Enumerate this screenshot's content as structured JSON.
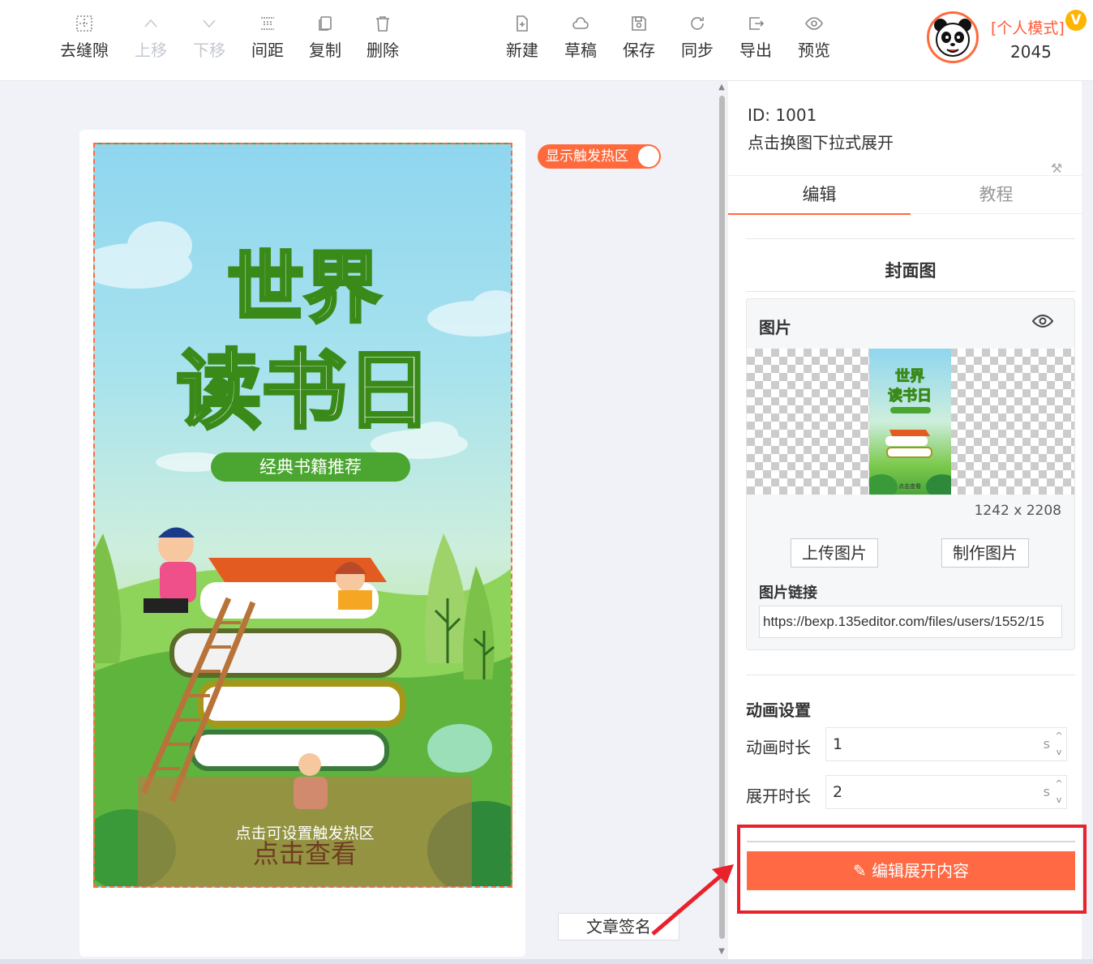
{
  "toolbar": {
    "left_items": [
      {
        "label": "去缝隙",
        "icon": "grid-icon",
        "disabled": false
      },
      {
        "label": "上移",
        "icon": "chevron-up-icon",
        "disabled": true
      },
      {
        "label": "下移",
        "icon": "chevron-down-icon",
        "disabled": true
      },
      {
        "label": "间距",
        "icon": "spacing-icon",
        "disabled": false
      },
      {
        "label": "复制",
        "icon": "copy-icon",
        "disabled": false
      },
      {
        "label": "删除",
        "icon": "trash-icon",
        "disabled": false
      }
    ],
    "right_items": [
      {
        "label": "新建",
        "icon": "new-file-icon"
      },
      {
        "label": "草稿",
        "icon": "cloud-icon"
      },
      {
        "label": "保存",
        "icon": "save-icon"
      },
      {
        "label": "同步",
        "icon": "sync-icon"
      },
      {
        "label": "导出",
        "icon": "export-icon"
      },
      {
        "label": "预览",
        "icon": "eye-icon"
      }
    ]
  },
  "user": {
    "mode": "[个人模式]",
    "vip_badge": "V",
    "number": "2045"
  },
  "canvas": {
    "toggle_label": "显示触发热区",
    "hotspot_hint": "点击可设置触发热区",
    "hotspot_cta": "点击查看",
    "poster_title_1": "世界",
    "poster_title_2": "读书日",
    "poster_subtitle": "经典书籍推荐",
    "sign_button": "文章签名"
  },
  "panel": {
    "id": "ID: 1001",
    "description": "点击换图下拉式展开",
    "tabs": [
      {
        "label": "编辑",
        "active": true
      },
      {
        "label": "教程",
        "active": false
      }
    ],
    "cover_title": "封面图",
    "image_box": {
      "title": "图片",
      "thumb_title_1": "世界",
      "thumb_title_2": "读书日",
      "thumb_cta": "点击查看",
      "size": "1242 x 2208",
      "upload_button": "上传图片",
      "make_button": "制作图片",
      "link_label": "图片链接",
      "link_value": "https://bexp.135editor.com/files/users/1552/15"
    },
    "animation": {
      "title": "动画设置",
      "duration_label": "动画时长",
      "duration_value": "1",
      "expand_label": "展开时长",
      "expand_value": "2",
      "unit": "s"
    },
    "edit_button": "编辑展开内容"
  },
  "colors": {
    "accent": "#ff6a3d",
    "highlight_box": "#e8212b"
  }
}
